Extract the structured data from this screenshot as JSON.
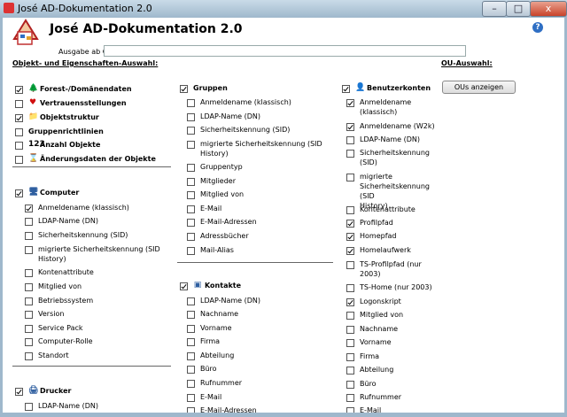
{
  "window": {
    "title": "José AD-Dokumentation 2.0",
    "min": "–",
    "max": "□",
    "close": "x"
  },
  "app": {
    "title": "José AD-Dokumentation 2.0",
    "help_icon": "?"
  },
  "output": {
    "label": "Ausgabe ab OU:",
    "value": ""
  },
  "headings": {
    "objects": "Objekt- und Eigenschaften-Auswahl:",
    "ou": "OU-Auswahl:"
  },
  "ou_button": "OUs anzeigen",
  "col1_top": [
    {
      "label": "Forest-/Domänendaten",
      "checked": true,
      "icon": "forest-icon",
      "glyph": "🌲"
    },
    {
      "label": "Vertrauensstellungen",
      "checked": false,
      "icon": "heart-icon",
      "glyph": "♥"
    },
    {
      "label": "Objektstruktur",
      "checked": true,
      "icon": "folder-icon",
      "glyph": "📁"
    },
    {
      "label": "Gruppenrichtlinien",
      "checked": false,
      "icon": "",
      "glyph": ""
    },
    {
      "label": "Anzahl Objekte",
      "checked": false,
      "icon": "count-icon",
      "glyph": "123"
    },
    {
      "label": "Änderungsdaten der Objekte",
      "checked": false,
      "icon": "calendar-icon",
      "glyph": "⌛"
    }
  ],
  "computer": {
    "label": "Computer",
    "checked": true,
    "items": [
      {
        "label": "Anmeldename (klassisch)",
        "checked": true
      },
      {
        "label": "LDAP-Name (DN)",
        "checked": false
      },
      {
        "label": "Sicherheitskennung (SID)",
        "checked": false
      },
      {
        "label": "migrierte Sicherheitskennung (SID",
        "label2": "History)",
        "checked": false
      },
      {
        "label": "Kontenattribute",
        "checked": false
      },
      {
        "label": "Mitglied von",
        "checked": false
      },
      {
        "label": "Betriebssystem",
        "checked": false
      },
      {
        "label": "Version",
        "checked": false
      },
      {
        "label": "Service Pack",
        "checked": false
      },
      {
        "label": "Computer-Rolle",
        "checked": false
      },
      {
        "label": "Standort",
        "checked": false
      }
    ]
  },
  "drucker": {
    "label": "Drucker",
    "checked": true,
    "items": [
      {
        "label": "LDAP-Name (DN)",
        "checked": false
      }
    ]
  },
  "gruppen": {
    "label": "Gruppen",
    "checked": true,
    "items": [
      {
        "label": "Anmeldename (klassisch)",
        "checked": false
      },
      {
        "label": "LDAP-Name (DN)",
        "checked": false
      },
      {
        "label": "Sicherheitskennung (SID)",
        "checked": false
      },
      {
        "label": "migrierte Sicherheitskennung (SID",
        "label2": "History)",
        "checked": false
      },
      {
        "label": "Gruppentyp",
        "checked": false
      },
      {
        "label": "Mitglieder",
        "checked": false
      },
      {
        "label": "Mitglied von",
        "checked": false
      },
      {
        "label": "E-Mail",
        "checked": false
      },
      {
        "label": "E-Mail-Adressen",
        "checked": false
      },
      {
        "label": "Adressbücher",
        "checked": false
      },
      {
        "label": "Mail-Alias",
        "checked": false
      }
    ]
  },
  "kontakte": {
    "label": "Kontakte",
    "checked": true,
    "items": [
      {
        "label": "LDAP-Name (DN)",
        "checked": false
      },
      {
        "label": "Nachname",
        "checked": false
      },
      {
        "label": "Vorname",
        "checked": false
      },
      {
        "label": "Firma",
        "checked": false
      },
      {
        "label": "Abteilung",
        "checked": false
      },
      {
        "label": "Büro",
        "checked": false
      },
      {
        "label": "Rufnummer",
        "checked": false
      },
      {
        "label": "E-Mail",
        "checked": false
      },
      {
        "label": "E-Mail-Adressen",
        "checked": false
      }
    ]
  },
  "benutzer": {
    "label": "Benutzerkonten",
    "checked": true,
    "items": [
      {
        "label": "Anmeldename",
        "label2": "(klassisch)",
        "checked": true
      },
      {
        "label": "Anmeldename (W2k)",
        "checked": true
      },
      {
        "label": "LDAP-Name (DN)",
        "checked": false
      },
      {
        "label": "Sicherheitskennung",
        "label2": "(SID)",
        "checked": false
      },
      {
        "label": "migrierte",
        "label2": "Sicherheitskennung (SID",
        "label3": "History)",
        "checked": false
      },
      {
        "label": "Kontenattribute",
        "checked": false
      },
      {
        "label": "Profilpfad",
        "checked": true
      },
      {
        "label": "Homepfad",
        "checked": true
      },
      {
        "label": "Homelaufwerk",
        "checked": true
      },
      {
        "label": "TS-Profilpfad (nur",
        "label2": "2003)",
        "checked": false
      },
      {
        "label": "TS-Home (nur 2003)",
        "checked": false
      },
      {
        "label": "Logonskript",
        "checked": true
      },
      {
        "label": "Mitglied von",
        "checked": false
      },
      {
        "label": "Nachname",
        "checked": false
      },
      {
        "label": "Vorname",
        "checked": false
      },
      {
        "label": "Firma",
        "checked": false
      },
      {
        "label": "Abteilung",
        "checked": false
      },
      {
        "label": "Büro",
        "checked": false
      },
      {
        "label": "Rufnummer",
        "checked": false
      },
      {
        "label": "E-Mail",
        "checked": false
      }
    ]
  }
}
